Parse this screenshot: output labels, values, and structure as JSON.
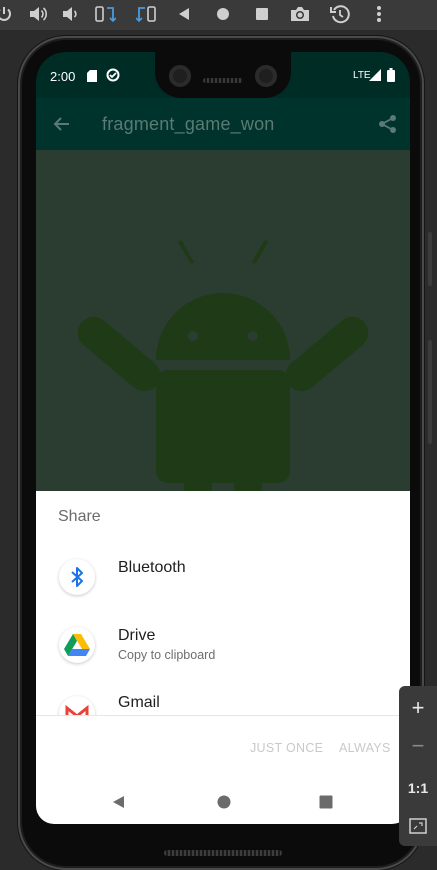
{
  "status_bar": {
    "time": "2:00",
    "network": "LTE"
  },
  "app_bar": {
    "title": "fragment_game_won"
  },
  "share_sheet": {
    "title": "Share",
    "items": [
      {
        "label": "Bluetooth",
        "subtitle": "",
        "icon": "bluetooth-icon"
      },
      {
        "label": "Drive",
        "subtitle": "Copy to clipboard",
        "icon": "google-drive-icon"
      },
      {
        "label": "Gmail",
        "subtitle": "",
        "icon": "gmail-icon"
      }
    ],
    "just_once": "JUST ONCE",
    "always": "ALWAYS"
  },
  "zoom": {
    "plus": "+",
    "minus": "−",
    "one_to_one": "1:1"
  },
  "colors": {
    "status_bar": "#002c26",
    "app_bar": "#00332c",
    "content_dim": "#2b3d31",
    "android_robot": "#1f3a16",
    "sheet": "#ffffff"
  }
}
